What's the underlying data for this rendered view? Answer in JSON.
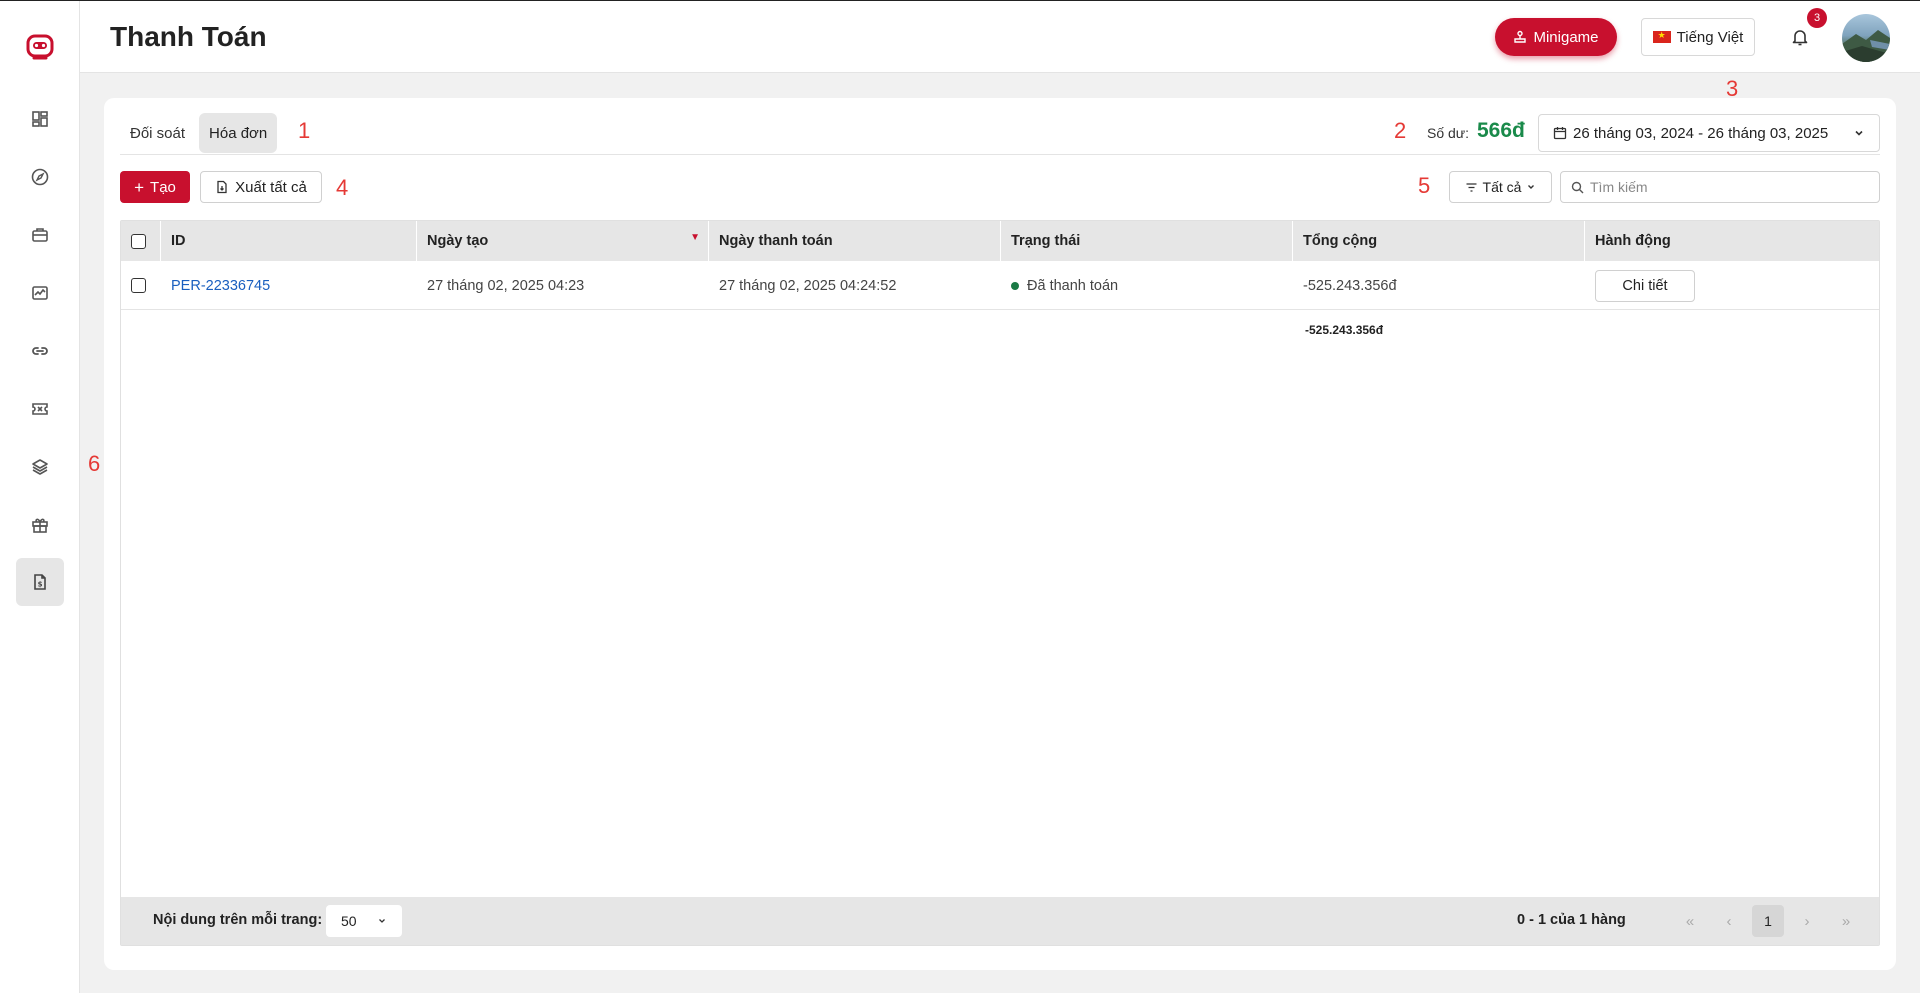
{
  "header": {
    "title": "Thanh Toán",
    "minigame_label": "Minigame",
    "language_label": "Tiếng Việt",
    "notification_count": "3"
  },
  "sidebar": {
    "items": [
      {
        "name": "dashboard-icon"
      },
      {
        "name": "compass-icon"
      },
      {
        "name": "briefcase-icon"
      },
      {
        "name": "chart-icon"
      },
      {
        "name": "link-icon"
      },
      {
        "name": "ticket-icon"
      },
      {
        "name": "layers-icon"
      },
      {
        "name": "gift-icon"
      },
      {
        "name": "invoice-icon",
        "active": true
      }
    ]
  },
  "tabs": [
    {
      "label": "Đối soát",
      "active": false
    },
    {
      "label": "Hóa đơn",
      "active": true
    }
  ],
  "markers": [
    "1",
    "2",
    "3",
    "4",
    "5",
    "6"
  ],
  "balance": {
    "label": "Số dư:",
    "value": "566đ"
  },
  "date_range": "26 tháng 03, 2024 - 26 tháng 03, 2025",
  "toolbar": {
    "create_label": "Tạo",
    "export_label": "Xuất tất cả",
    "filter_label": "Tất cả",
    "search_placeholder": "Tìm kiếm"
  },
  "table": {
    "columns": [
      "ID",
      "Ngày tạo",
      "Ngày thanh toán",
      "Trạng thái",
      "Tổng cộng",
      "Hành động"
    ],
    "rows": [
      {
        "id": "PER-22336745",
        "created": "27 tháng 02, 2025 04:23",
        "paid": "27 tháng 02, 2025 04:24:52",
        "status": "Đã thanh toán",
        "total": "-525.243.356đ",
        "action": "Chi tiết"
      }
    ],
    "sum": "-525.243.356đ"
  },
  "footer": {
    "rows_per_page_label": "Nội dung trên mỗi trang:",
    "rows_per_page_value": "50",
    "range_text": "0 - 1 của 1 hàng",
    "current_page": "1"
  },
  "colors": {
    "accent": "#c8102e",
    "balance": "#1a8a4a",
    "link": "#1a5fbf",
    "status_paid": "#1a7a45",
    "marker": "#e53935"
  }
}
